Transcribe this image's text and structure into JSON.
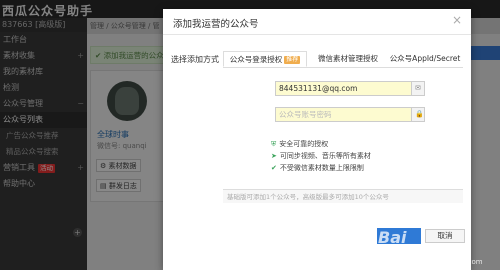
{
  "app": {
    "title": "西瓜公众号助手",
    "account": "837663 [高级版]"
  },
  "sidebar": {
    "items": [
      {
        "label": "工作台"
      },
      {
        "label": "素材收集"
      },
      {
        "label": "我的素材库"
      },
      {
        "label": "检测"
      },
      {
        "label": "公众号管理"
      },
      {
        "label": "公众号列表"
      },
      {
        "label": "广告公众号推荐"
      },
      {
        "label": "精品公众号搜索"
      },
      {
        "label": "营销工具",
        "badge": "活动"
      },
      {
        "label": "帮助中心"
      }
    ]
  },
  "background": {
    "breadcrumb": "管理 / 公众号管理 / 管",
    "notice": "添加我运营的公众号",
    "profile_name": "全球时事",
    "profile_wx": "微信号: quanqi",
    "btn_material": "素材数据",
    "btn_log": "群发日志"
  },
  "modal": {
    "title": "添加我运营的公众号",
    "method_label": "选择添加方式",
    "tabs": [
      {
        "label": "公众号登录授权",
        "badge": "推荐"
      },
      {
        "label": "微信素材管理授权"
      },
      {
        "label": "公众号AppId/Secret"
      }
    ],
    "email_value": "844531131@qq.com",
    "password_placeholder": "公众号账号密码",
    "features": [
      "安全可靠的授权",
      "可同步视频、音乐等所有素材",
      "不受微信素材数量上限限制"
    ],
    "footer_note": "基础版可添加1个公众号，高级版最多可添加10个公众号",
    "cancel_label": "取消"
  },
  "watermark": {
    "text": "Bai",
    "url": "jingyan.baidu.com"
  }
}
